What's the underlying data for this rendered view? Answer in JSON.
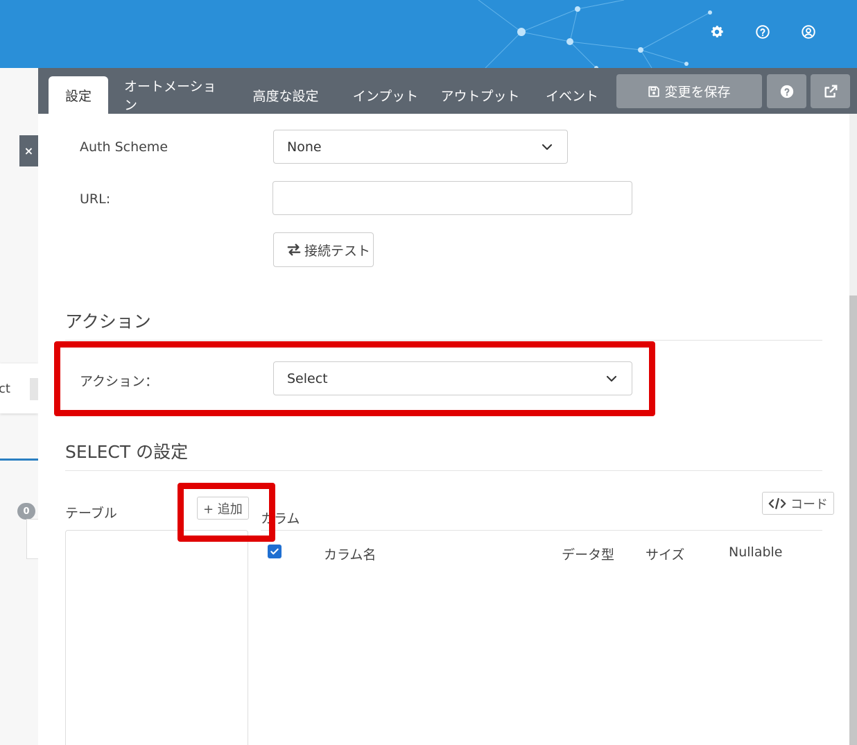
{
  "header": {
    "icons": [
      "gear-icon",
      "help-circle-icon",
      "user-circle-icon"
    ]
  },
  "left_peek": {
    "close_label": "×",
    "card_text": "ct",
    "badge": "0"
  },
  "tabs": [
    {
      "label": "設定",
      "active": true
    },
    {
      "label": "オートメーション",
      "active": false
    },
    {
      "label": "高度な設定",
      "active": false
    },
    {
      "label": "インプット",
      "active": false
    },
    {
      "label": "アウトプット",
      "active": false
    },
    {
      "label": "イベント",
      "active": false
    }
  ],
  "toolbar": {
    "save_label": "変更を保存",
    "help_icon": "question-icon",
    "external_icon": "external-link-icon"
  },
  "connection": {
    "auth_label": "Auth Scheme",
    "auth_value": "None",
    "url_label": "URL:",
    "url_value": "",
    "test_button": "接続テスト"
  },
  "action_section": {
    "title": "アクション",
    "action_label": "アクション：",
    "action_value": "Select"
  },
  "select_section": {
    "title": "SELECT の設定",
    "table_label": "テーブル",
    "add_button": "+ 追加",
    "column_label": "カラム",
    "code_button": "コード",
    "columns": [
      "カラム名",
      "データ型",
      "サイズ",
      "Nullable"
    ],
    "select_all_checked": true
  },
  "colors": {
    "header_blue": "#2a8fd8",
    "tab_bar": "#5d6670",
    "highlight_red": "#e00000",
    "checkbox_blue": "#1f6fd1"
  }
}
